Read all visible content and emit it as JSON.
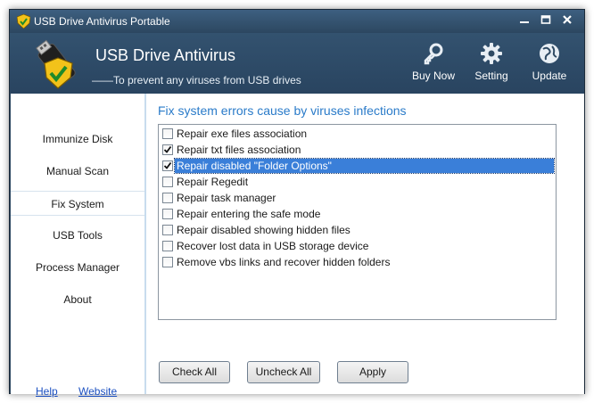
{
  "window": {
    "title": "USB Drive Antivirus Portable"
  },
  "header": {
    "app_name": "USB Drive Antivirus",
    "tagline": "——To prevent any viruses from USB drives",
    "buttons": [
      {
        "label": "Buy Now",
        "icon": "key-icon"
      },
      {
        "label": "Setting",
        "icon": "gear-icon"
      },
      {
        "label": "Update",
        "icon": "globe-icon"
      }
    ]
  },
  "sidebar": {
    "items": [
      {
        "label": "Immunize Disk"
      },
      {
        "label": "Manual Scan"
      },
      {
        "label": "Fix System",
        "active": true
      },
      {
        "label": "USB Tools"
      },
      {
        "label": "Process Manager"
      },
      {
        "label": "About"
      }
    ],
    "help_label": "Help",
    "website_label": "Website"
  },
  "main": {
    "title": "Fix system errors cause by viruses infections",
    "items": [
      {
        "label": "Repair exe files association",
        "checked": false
      },
      {
        "label": "Repair txt files association",
        "checked": true
      },
      {
        "label": "Repair disabled \"Folder Options\"",
        "checked": true,
        "selected": true
      },
      {
        "label": "Repair Regedit",
        "checked": false
      },
      {
        "label": "Repair task manager",
        "checked": false
      },
      {
        "label": "Repair entering the safe mode",
        "checked": false
      },
      {
        "label": "Repair disabled showing hidden files",
        "checked": false
      },
      {
        "label": "Recover lost data in USB storage device",
        "checked": false
      },
      {
        "label": "Remove vbs links and recover hidden folders",
        "checked": false
      }
    ],
    "buttons": {
      "check_all": "Check All",
      "uncheck_all": "Uncheck All",
      "apply": "Apply"
    }
  },
  "colors": {
    "header_bg": "#2f4a63",
    "accent_title": "#2a7bc9",
    "selection": "#3a7fd9",
    "link": "#1a4fc0"
  }
}
